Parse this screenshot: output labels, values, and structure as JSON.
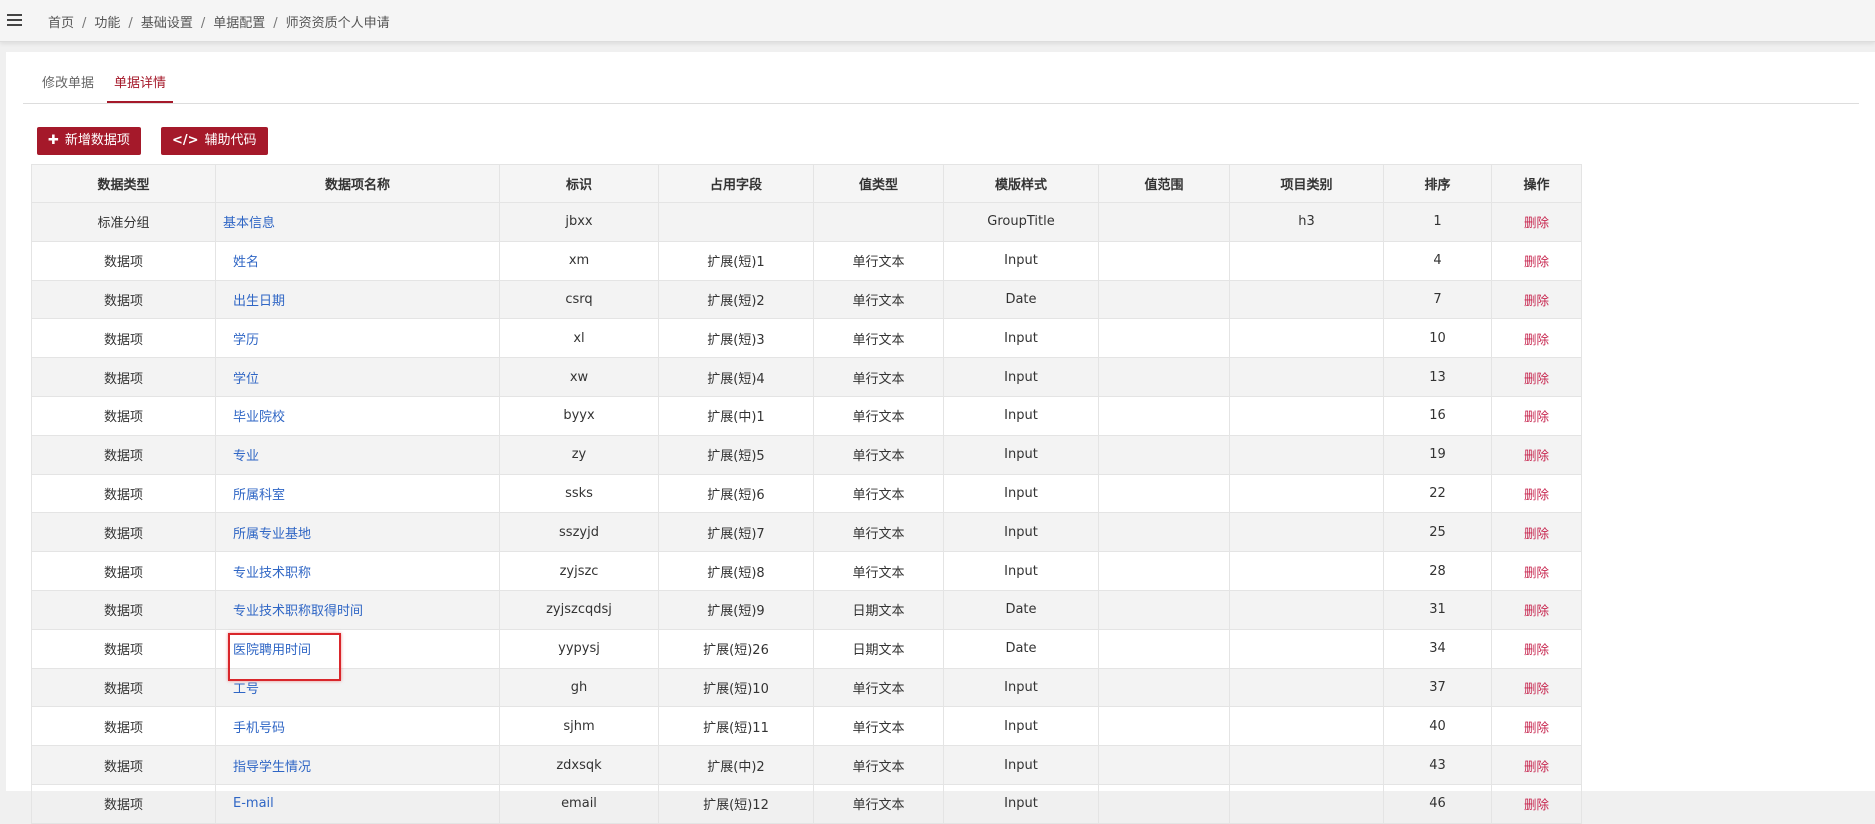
{
  "breadcrumb": [
    "首页",
    "功能",
    "基础设置",
    "单据配置",
    "师资资质个人申请"
  ],
  "tabs": {
    "edit": "修改单据",
    "detail": "单据详情"
  },
  "toolbar": {
    "add_label": "新增数据项",
    "code_label": "辅助代码"
  },
  "table": {
    "headers": [
      "数据类型",
      "数据项名称",
      "标识",
      "占用字段",
      "值类型",
      "模版样式",
      "值范围",
      "项目类别",
      "排序",
      "操作"
    ],
    "rows": [
      {
        "type": "标准分组",
        "name": "基本信息",
        "key": "jbxx",
        "field": "",
        "value_type": "",
        "style": "GroupTitle",
        "range": "",
        "category": "h3",
        "order": "1",
        "action": "删除"
      },
      {
        "type": "数据项",
        "name": "姓名",
        "key": "xm",
        "field": "扩展(短)1",
        "value_type": "单行文本",
        "style": "Input",
        "range": "",
        "category": "",
        "order": "4",
        "action": "删除"
      },
      {
        "type": "数据项",
        "name": "出生日期",
        "key": "csrq",
        "field": "扩展(短)2",
        "value_type": "单行文本",
        "style": "Date",
        "range": "",
        "category": "",
        "order": "7",
        "action": "删除"
      },
      {
        "type": "数据项",
        "name": "学历",
        "key": "xl",
        "field": "扩展(短)3",
        "value_type": "单行文本",
        "style": "Input",
        "range": "",
        "category": "",
        "order": "10",
        "action": "删除"
      },
      {
        "type": "数据项",
        "name": "学位",
        "key": "xw",
        "field": "扩展(短)4",
        "value_type": "单行文本",
        "style": "Input",
        "range": "",
        "category": "",
        "order": "13",
        "action": "删除"
      },
      {
        "type": "数据项",
        "name": "毕业院校",
        "key": "byyx",
        "field": "扩展(中)1",
        "value_type": "单行文本",
        "style": "Input",
        "range": "",
        "category": "",
        "order": "16",
        "action": "删除"
      },
      {
        "type": "数据项",
        "name": "专业",
        "key": "zy",
        "field": "扩展(短)5",
        "value_type": "单行文本",
        "style": "Input",
        "range": "",
        "category": "",
        "order": "19",
        "action": "删除"
      },
      {
        "type": "数据项",
        "name": "所属科室",
        "key": "ssks",
        "field": "扩展(短)6",
        "value_type": "单行文本",
        "style": "Input",
        "range": "",
        "category": "",
        "order": "22",
        "action": "删除"
      },
      {
        "type": "数据项",
        "name": "所属专业基地",
        "key": "sszyjd",
        "field": "扩展(短)7",
        "value_type": "单行文本",
        "style": "Input",
        "range": "",
        "category": "",
        "order": "25",
        "action": "删除"
      },
      {
        "type": "数据项",
        "name": "专业技术职称",
        "key": "zyjszc",
        "field": "扩展(短)8",
        "value_type": "单行文本",
        "style": "Input",
        "range": "",
        "category": "",
        "order": "28",
        "action": "删除"
      },
      {
        "type": "数据项",
        "name": "专业技术职称取得时间",
        "key": "zyjszcqdsj",
        "field": "扩展(短)9",
        "value_type": "日期文本",
        "style": "Date",
        "range": "",
        "category": "",
        "order": "31",
        "action": "删除"
      },
      {
        "type": "数据项",
        "name": "医院聘用时间",
        "key": "yypysj",
        "field": "扩展(短)26",
        "value_type": "日期文本",
        "style": "Date",
        "range": "",
        "category": "",
        "order": "34",
        "action": "删除"
      },
      {
        "type": "数据项",
        "name": "工号",
        "key": "gh",
        "field": "扩展(短)10",
        "value_type": "单行文本",
        "style": "Input",
        "range": "",
        "category": "",
        "order": "37",
        "action": "删除"
      },
      {
        "type": "数据项",
        "name": "手机号码",
        "key": "sjhm",
        "field": "扩展(短)11",
        "value_type": "单行文本",
        "style": "Input",
        "range": "",
        "category": "",
        "order": "40",
        "action": "删除"
      },
      {
        "type": "数据项",
        "name": "指导学生情况",
        "key": "zdxsqk",
        "field": "扩展(中)2",
        "value_type": "单行文本",
        "style": "Input",
        "range": "",
        "category": "",
        "order": "43",
        "action": "删除"
      },
      {
        "type": "数据项",
        "name": "E-mail",
        "key": "email",
        "field": "扩展(短)12",
        "value_type": "单行文本",
        "style": "Input",
        "range": "",
        "category": "",
        "order": "46",
        "action": "删除"
      }
    ]
  },
  "colors": {
    "accent": "#a5192a",
    "link": "#2f66c5",
    "delete": "#c7254e",
    "highlight": "#d9262b"
  }
}
